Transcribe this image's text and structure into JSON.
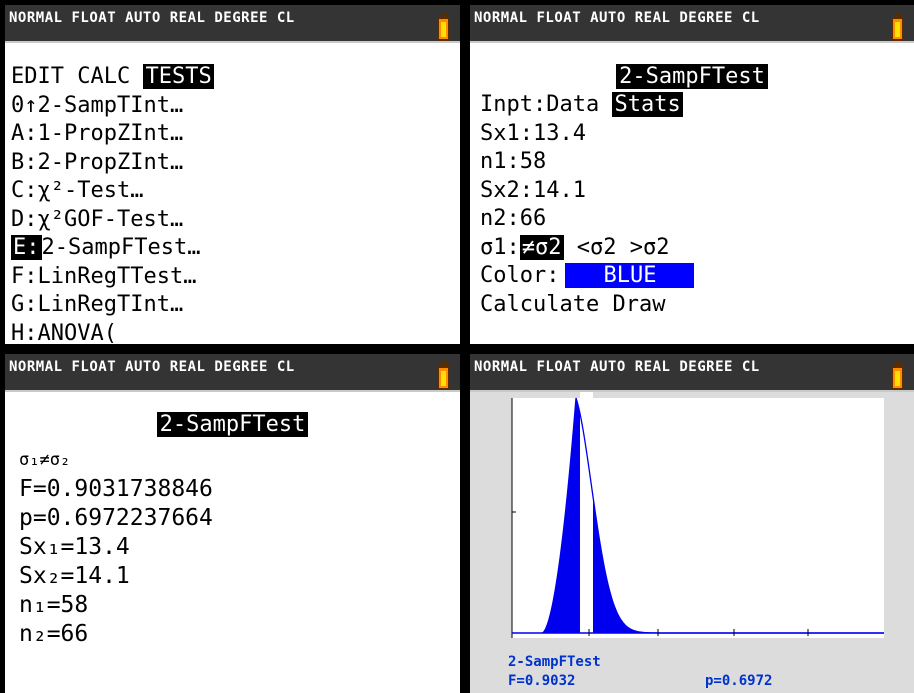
{
  "status_bar": {
    "text": "NORMAL FLOAT AUTO REAL DEGREE CL"
  },
  "tests_menu": {
    "tabs": [
      "EDIT",
      "CALC",
      "TESTS"
    ],
    "items": [
      {
        "key": "0↑",
        "label": "2-SampTInt…"
      },
      {
        "key": "A:",
        "label": "1-PropZInt…"
      },
      {
        "key": "B:",
        "label": "2-PropZInt…"
      },
      {
        "key": "C:",
        "label": "χ²-Test…"
      },
      {
        "key": "D:",
        "label": "χ²GOF-Test…"
      },
      {
        "key": "E:",
        "label": "2-SampFTest…"
      },
      {
        "key": "F:",
        "label": "LinRegTTest…"
      },
      {
        "key": "G:",
        "label": "LinRegTInt…"
      },
      {
        "key": "H:",
        "label": "ANOVA("
      }
    ]
  },
  "input_screen": {
    "title": "2-SampFTest",
    "inpt_label": "Inpt:",
    "inpt_options": [
      "Data",
      "Stats"
    ],
    "sx1": "Sx1:13.4",
    "n1": "n1:58",
    "sx2": "Sx2:14.1",
    "n2": "n2:66",
    "sigma_label": "σ1:",
    "sigma_options": [
      "≠σ2",
      "<σ2",
      ">σ2"
    ],
    "color_label": "Color:",
    "color_value": "BLUE",
    "calculate": "Calculate",
    "draw": "Draw"
  },
  "results_screen": {
    "title": "2-SampFTest",
    "lines": [
      "σ₁≠σ₂",
      "F=0.9031738846",
      "p=0.6972237664",
      "Sx₁=13.4",
      "Sx₂=14.1",
      "n₁=58",
      "n₂=66"
    ]
  },
  "graph_screen": {
    "title": "2-SampFTest",
    "f_text": "F=0.9032",
    "p_text": "p=0.6972"
  },
  "colors": {
    "accent": "#0000ff",
    "status_bg": "#343434",
    "battery": "#ff8c00"
  }
}
